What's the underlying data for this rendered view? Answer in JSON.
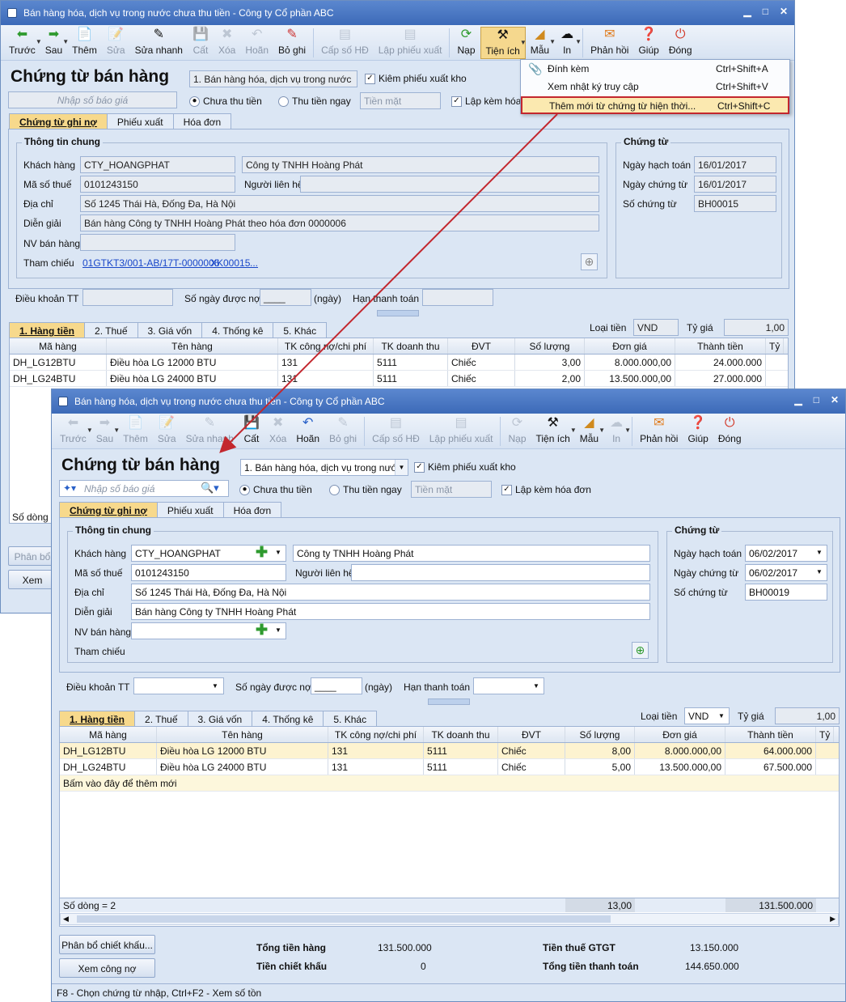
{
  "window_title": "Bán hàng hóa, dịch vụ trong nước chưa thu tiền - Công ty Cổ phần ABC",
  "toolbar": [
    "Trước",
    "Sau",
    "Thêm",
    "Sửa",
    "Sửa nhanh",
    "Cất",
    "Xóa",
    "Hoãn",
    "Bỏ ghi",
    "Cấp số HĐ",
    "Lập phiếu xuất",
    "Nạp",
    "Tiện ích",
    "Mẫu",
    "In",
    "Phản hồi",
    "Giúp",
    "Đóng"
  ],
  "form_title": "Chứng từ bán hàng",
  "sale_type": "1. Bán hàng hóa, dịch vụ trong nước",
  "check_stock_label": "Kiêm phiếu xuất kho",
  "quote_placeholder": "Nhập số báo giá",
  "radio_unpaid": "Chưa thu tiền",
  "radio_paid": "Thu tiền ngay",
  "payment_method": "Tiền mặt",
  "invoice_label_short": "Lập kèm hóa",
  "invoice_label": "Lập kèm hóa đơn",
  "doc_tabs": [
    "Chứng từ ghi nợ",
    "Phiếu xuất",
    "Hóa đơn"
  ],
  "labels": {
    "general": "Thông tin chung",
    "customer": "Khách hàng",
    "tax_code": "Mã số thuế",
    "contact": "Người liên hệ",
    "address": "Địa chỉ",
    "description": "Diễn giải",
    "salesperson": "NV bán hàng",
    "reference": "Tham chiếu",
    "voucher": "Chứng từ",
    "posting_date": "Ngày hạch toán",
    "voucher_date": "Ngày chứng từ",
    "voucher_no": "Số chứng từ",
    "payment_terms": "Điều khoản TT",
    "credit_days": "Số ngày được nợ",
    "days_unit": "(ngày)",
    "due_date": "Hạn thanh toán",
    "currency": "Loại tiền",
    "rate": "Tỷ giá"
  },
  "back": {
    "customer_code": "CTY_HOANGPHAT",
    "customer_name": "Công ty TNHH Hoàng Phát",
    "tax_code": "0101243150",
    "address": "Số 1245 Thái Hà, Đống Đa, Hà Nội",
    "description": "Bán hàng Công ty TNHH Hoàng Phát theo hóa đơn 0000006",
    "reference_1": "01GTKT3/001-AB/17T-0000006",
    "reference_2": "XK00015",
    "reference_more": "...",
    "posting_date": "16/01/2017",
    "voucher_date": "16/01/2017",
    "voucher_no": "BH00015",
    "credit_days": "____",
    "currency": "VND",
    "rate": "1,00",
    "rows": [
      [
        "DH_LG12BTU",
        "Điều hòa LG 12000 BTU",
        "131",
        "5111",
        "Chiếc",
        "3,00",
        "8.000.000,00",
        "24.000.000"
      ],
      [
        "DH_LG24BTU",
        "Điều hòa LG 24000 BTU",
        "131",
        "5111",
        "Chiếc",
        "2,00",
        "13.500.000,00",
        "27.000.000"
      ]
    ],
    "row_count_short": "Số dòng",
    "alloc_short": "Phân bổ",
    "view_short": "Xem"
  },
  "menu": [
    {
      "label": "Đính kèm",
      "shortcut": "Ctrl+Shift+A"
    },
    {
      "label": "Xem nhật ký truy cập",
      "shortcut": "Ctrl+Shift+V"
    },
    {
      "label": "Thêm mới từ chứng từ hiện thời...",
      "shortcut": "Ctrl+Shift+C"
    }
  ],
  "detail_tabs": [
    "1. Hàng tiền",
    "2. Thuế",
    "3. Giá vốn",
    "4. Thống kê",
    "5. Khác"
  ],
  "grid_headers": [
    "Mã hàng",
    "Tên hàng",
    "TK công nợ/chi phí",
    "TK doanh thu",
    "ĐVT",
    "Số lượng",
    "Đơn giá",
    "Thành tiền",
    "Tỷ l"
  ],
  "front": {
    "customer_code": "CTY_HOANGPHAT",
    "customer_name": "Công ty TNHH Hoàng Phát",
    "tax_code": "0101243150",
    "address": "Số 1245 Thái Hà, Đống Đa, Hà Nội",
    "description": "Bán hàng Công ty TNHH Hoàng Phát",
    "posting_date": "06/02/2017",
    "voucher_date": "06/02/2017",
    "voucher_no": "BH00019",
    "credit_days": "____",
    "currency": "VND",
    "rate": "1,00",
    "rows": [
      [
        "DH_LG12BTU",
        "Điều hòa LG 12000 BTU",
        "131",
        "5111",
        "Chiếc",
        "8,00",
        "8.000.000,00",
        "64.000.000"
      ],
      [
        "DH_LG24BTU",
        "Điều hòa LG 24000 BTU",
        "131",
        "5111",
        "Chiếc",
        "5,00",
        "13.500.000,00",
        "67.500.000"
      ]
    ],
    "add_row_hint": "Bấm vào đây để thêm mới",
    "row_count": "Số dòng = 2",
    "sum_qty": "13,00",
    "sum_amount": "131.500.000",
    "alloc_btn": "Phân bổ chiết khấu...",
    "view_debt_btn": "Xem công nợ",
    "totals": {
      "goods_label": "Tổng tiền hàng",
      "goods": "131.500.000",
      "discount_label": "Tiền chiết khấu",
      "discount": "0",
      "vat_label": "Tiền thuế GTGT",
      "vat": "13.150.000",
      "pay_label": "Tổng tiền thanh toán",
      "pay": "144.650.000"
    },
    "status": "F8 - Chọn chứng từ nhập, Ctrl+F2 - Xem số tồn"
  },
  "colors": {
    "accent": "#f7d98c",
    "highlight_border": "#c3272e",
    "arrow": "#c3272e",
    "window_bg": "#dbe6f4"
  }
}
